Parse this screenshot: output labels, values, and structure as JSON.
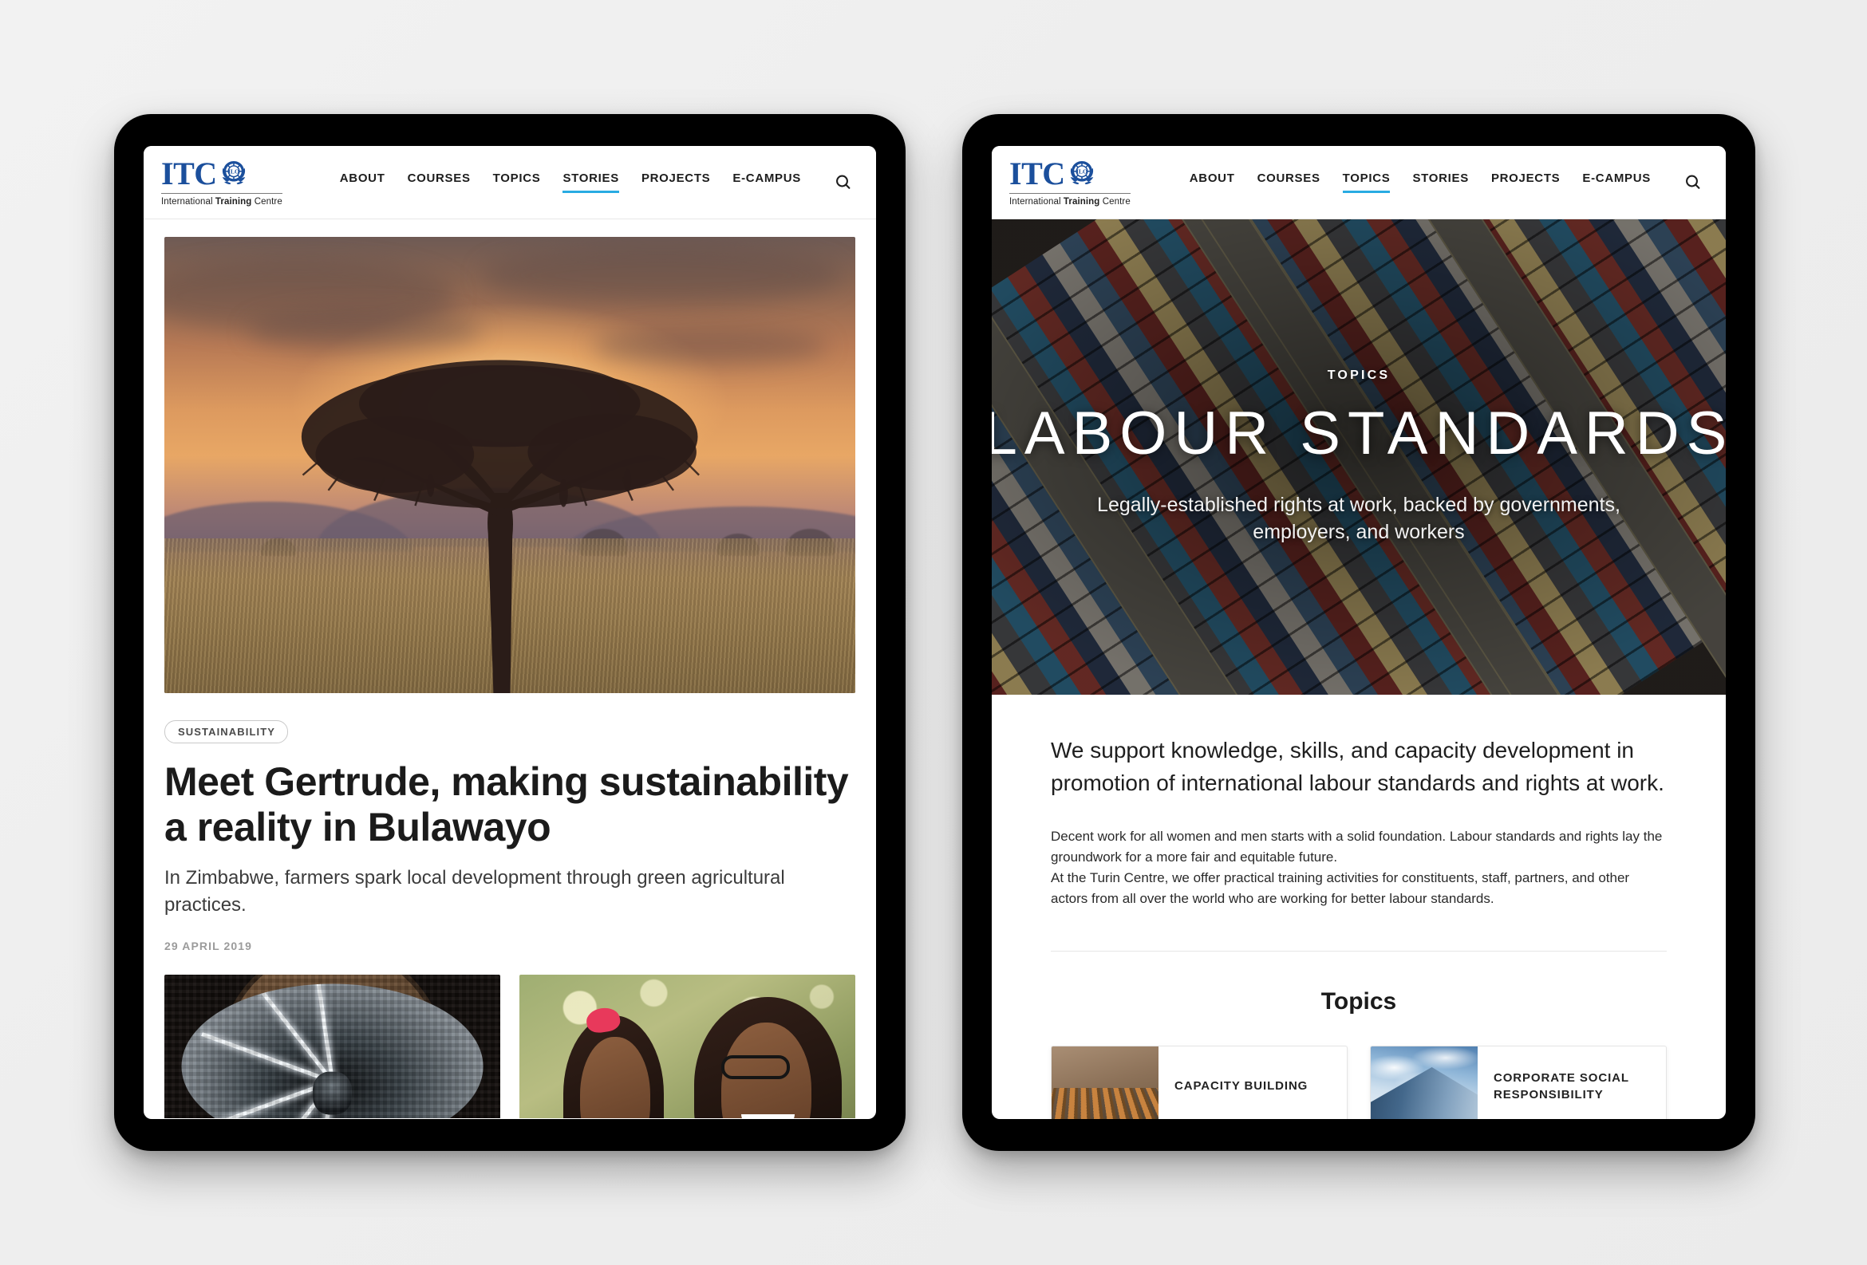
{
  "brand": {
    "name": "ITC",
    "subtitle_pre": "International ",
    "subtitle_bold": "Training",
    "subtitle_post": " Centre",
    "logo_color": "#1b4f9c",
    "emblem_name": "ilo-laurel-gear-emblem"
  },
  "accent_color": "#29abe2",
  "nav": {
    "items": [
      "ABOUT",
      "COURSES",
      "TOPICS",
      "STORIES",
      "PROJECTS",
      "E-CAMPUS"
    ],
    "search_icon": "search-icon"
  },
  "left_tablet": {
    "active_nav": "STORIES",
    "hero_image_alt": "acacia-tree-savanna-sunset",
    "tag": "SUSTAINABILITY",
    "title": "Meet Gertrude, making sustainability a reality in Bulawayo",
    "standfirst": "In Zimbabwe, farmers spark local development through green agricultural practices.",
    "date": "29 APRIL 2019",
    "thumbnails": [
      {
        "alt": "metallic-tunnel-interior-lights"
      },
      {
        "alt": "two-smiling-people-outdoors"
      }
    ]
  },
  "right_tablet": {
    "active_nav": "TOPICS",
    "hero": {
      "background_alt": "aerial-shipping-containers-port",
      "eyebrow": "TOPICS",
      "title": "LABOUR STANDARDS",
      "subtitle": "Legally-established rights at work, backed by governments, employers, and workers"
    },
    "lead": "We support knowledge, skills, and capacity development in promotion of international labour standards and rights at work.",
    "paragraph_1": "Decent work for all women and men starts with a solid foundation. Labour standards and rights lay the groundwork for a more fair and equitable future.",
    "paragraph_2": "At the Turin Centre, we offer practical training activities for constituents, staff, partners, and other actors from all over the world who are working for better labour standards.",
    "topics_heading": "Topics",
    "topic_cards": [
      {
        "label": "CAPACITY BUILDING",
        "image_alt": "auditorium-chairs"
      },
      {
        "label": "CORPORATE SOCIAL RESPONSIBILITY",
        "image_alt": "glass-skyscraper-clouds"
      }
    ]
  }
}
